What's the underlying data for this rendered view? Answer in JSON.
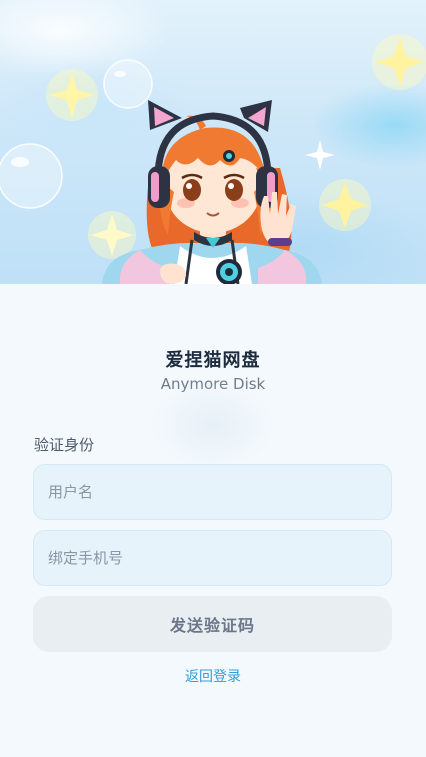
{
  "header": {
    "title": "爱捏猫网盘",
    "subtitle": "Anymore Disk"
  },
  "form": {
    "section_label": "验证身份",
    "username_placeholder": "用户名",
    "phone_placeholder": "绑定手机号",
    "send_button_label": "发送验证码",
    "back_link_label": "返回登录"
  },
  "colors": {
    "accent": "#2f9fd8",
    "background": "#f4f9fd",
    "input_bg": "#e6f3fb",
    "button_disabled_bg": "#e9eef2"
  }
}
